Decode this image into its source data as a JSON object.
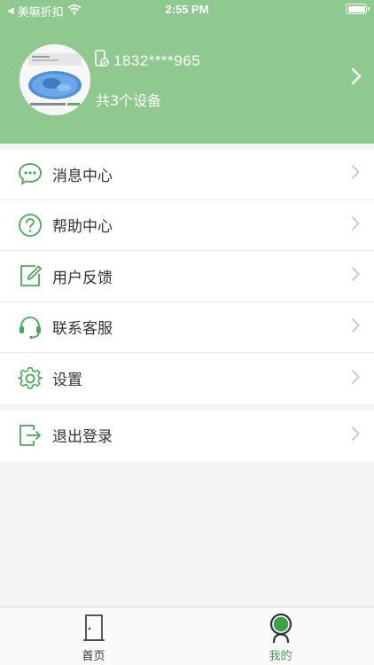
{
  "status_bar": {
    "carrier": "美嘛折扣",
    "time": "2:55 PM"
  },
  "profile": {
    "phone": "1832****965",
    "device_count": "共3个设备"
  },
  "menu": {
    "group1": [
      {
        "label": "消息中心",
        "icon": "message-icon"
      },
      {
        "label": "帮助中心",
        "icon": "help-icon"
      },
      {
        "label": "用户反馈",
        "icon": "feedback-icon"
      },
      {
        "label": "联系客服",
        "icon": "headset-icon"
      },
      {
        "label": "设置",
        "icon": "gear-icon"
      }
    ],
    "group2": [
      {
        "label": "退出登录",
        "icon": "logout-icon"
      }
    ]
  },
  "tab_bar": {
    "tabs": [
      {
        "label": "首页",
        "icon": "door-icon",
        "active": false
      },
      {
        "label": "我的",
        "icon": "user-icon",
        "active": true
      }
    ]
  },
  "colors": {
    "header_bg": "#8fc98f",
    "accent": "#3aa24a",
    "icon": "#4aa85a"
  }
}
